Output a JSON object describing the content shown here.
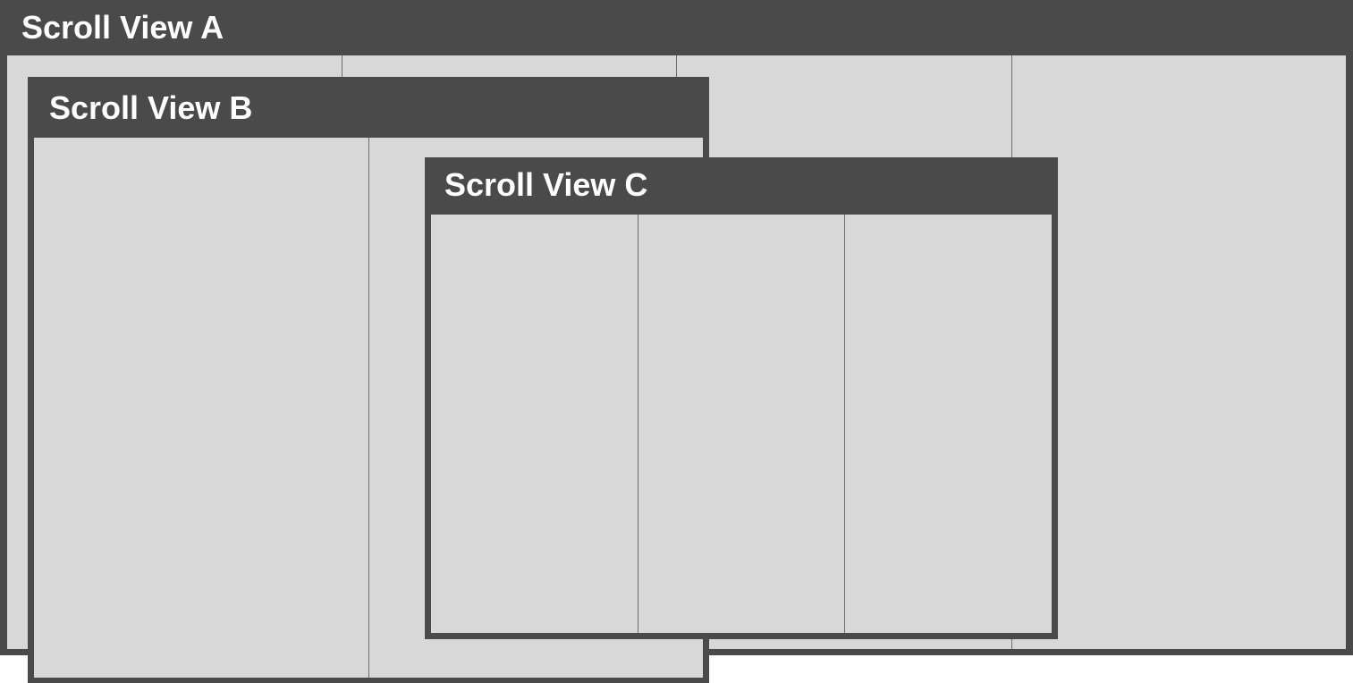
{
  "colors": {
    "header": "#4a4a4a",
    "content": "#d8d8d8",
    "divider": "#6e6e6e",
    "title_text": "#ffffff"
  },
  "scroll_views": [
    {
      "title": "Scroll View A",
      "columns": 4
    },
    {
      "title": "Scroll View B",
      "columns": 2
    },
    {
      "title": "Scroll View C",
      "columns": 3
    }
  ]
}
